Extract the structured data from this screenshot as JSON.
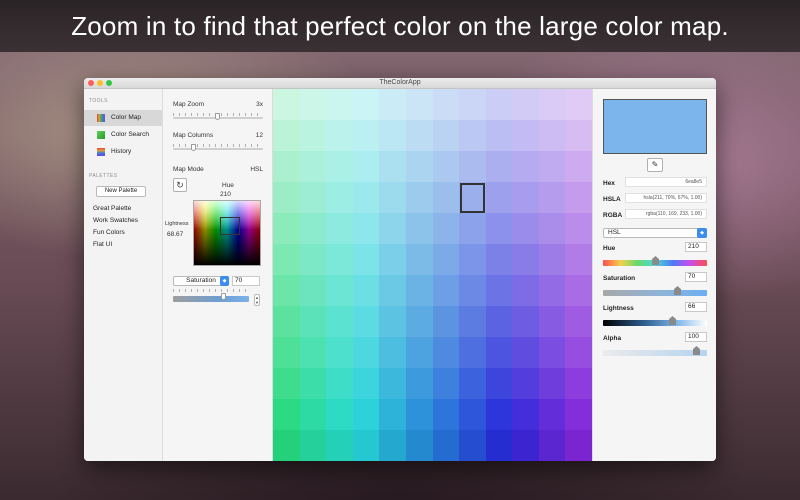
{
  "banner": {
    "text": "Zoom in to find that perfect color on the large color map."
  },
  "window": {
    "title": "TheColorApp"
  },
  "sidebar": {
    "tools_header": "TOOLS",
    "tools": [
      {
        "label": "Color Map",
        "icon": "color-map-icon",
        "selected": true
      },
      {
        "label": "Color Search",
        "icon": "color-search-icon",
        "selected": false
      },
      {
        "label": "History",
        "icon": "history-icon",
        "selected": false
      }
    ],
    "palettes_header": "PALETTES",
    "new_palette_label": "New Palette",
    "palettes": [
      "Great Palette",
      "Work Swatches",
      "Fun Colors",
      "Flat UI"
    ]
  },
  "controls": {
    "map_zoom_label": "Map Zoom",
    "map_zoom_value": "3x",
    "map_columns_label": "Map Columns",
    "map_columns_value": "12",
    "map_mode_label": "Map Mode",
    "map_mode_value": "HSL",
    "hue_label": "Hue",
    "hue_value": "210",
    "lightness_label": "Lightness",
    "lightness_value": "68.67",
    "saturation_select": "Saturation",
    "saturation_value": "70"
  },
  "color_map": {
    "columns": 12,
    "rows": 12,
    "selected_col": 7,
    "selected_row": 3
  },
  "inspector": {
    "swatch_color": "#7bb5ec",
    "hex_label": "Hex",
    "hex_value": "6ea8e5",
    "hsla_label": "HSLA",
    "hsla_value": "hsla(211, 70%, 67%, 1.00)",
    "rgba_label": "RGBA",
    "rgba_value": "rgba(110, 169, 233, 1.00)",
    "mode_value": "HSL",
    "hue_label": "Hue",
    "hue_value": "210",
    "saturation_label": "Saturation",
    "saturation_value": "70",
    "lightness_label": "Lightness",
    "lightness_value": "66",
    "alpha_label": "Alpha",
    "alpha_value": "100"
  }
}
